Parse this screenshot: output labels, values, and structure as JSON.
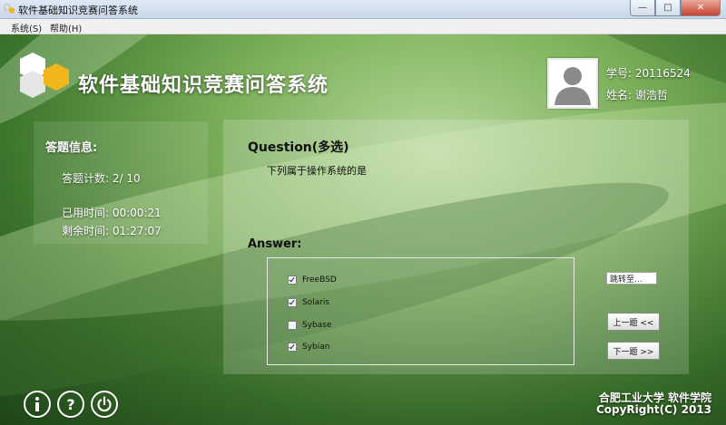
{
  "window": {
    "title": "软件基础知识竞赛问答系统"
  },
  "menu": {
    "items": [
      "系统(S)",
      "帮助(H)"
    ]
  },
  "header": {
    "app_title": "软件基础知识竞赛问答系统"
  },
  "user": {
    "id_label": "学号: 20116524",
    "name_label": "姓名: 谢浩哲"
  },
  "info": {
    "heading": "答题信息:",
    "count": "答题计数:  2/ 10",
    "elapsed": "已用时间:   00:00:21",
    "remaining": "剩余时间:  01:27:07"
  },
  "question": {
    "title": "Question(多选)",
    "text": "下列属于操作系统的是"
  },
  "answer": {
    "title": "Answer:",
    "options": [
      {
        "label": "FreeBSD",
        "checked": true
      },
      {
        "label": "Solaris",
        "checked": true
      },
      {
        "label": "Sybase",
        "checked": false
      },
      {
        "label": "Sybian",
        "checked": true
      }
    ]
  },
  "nav": {
    "jump_value": "跳转至...",
    "prev": "上一题 <<",
    "next": "下一题 >>"
  },
  "bottom_icons": [
    "info-icon",
    "help-icon",
    "power-icon"
  ],
  "footer": {
    "line1": "合肥工业大学 软件学院",
    "line2": "CopyRight(C) 2013"
  },
  "colors": {
    "accent_logo_yellow": "#f2b51c",
    "background_green": "#7fb45d"
  }
}
